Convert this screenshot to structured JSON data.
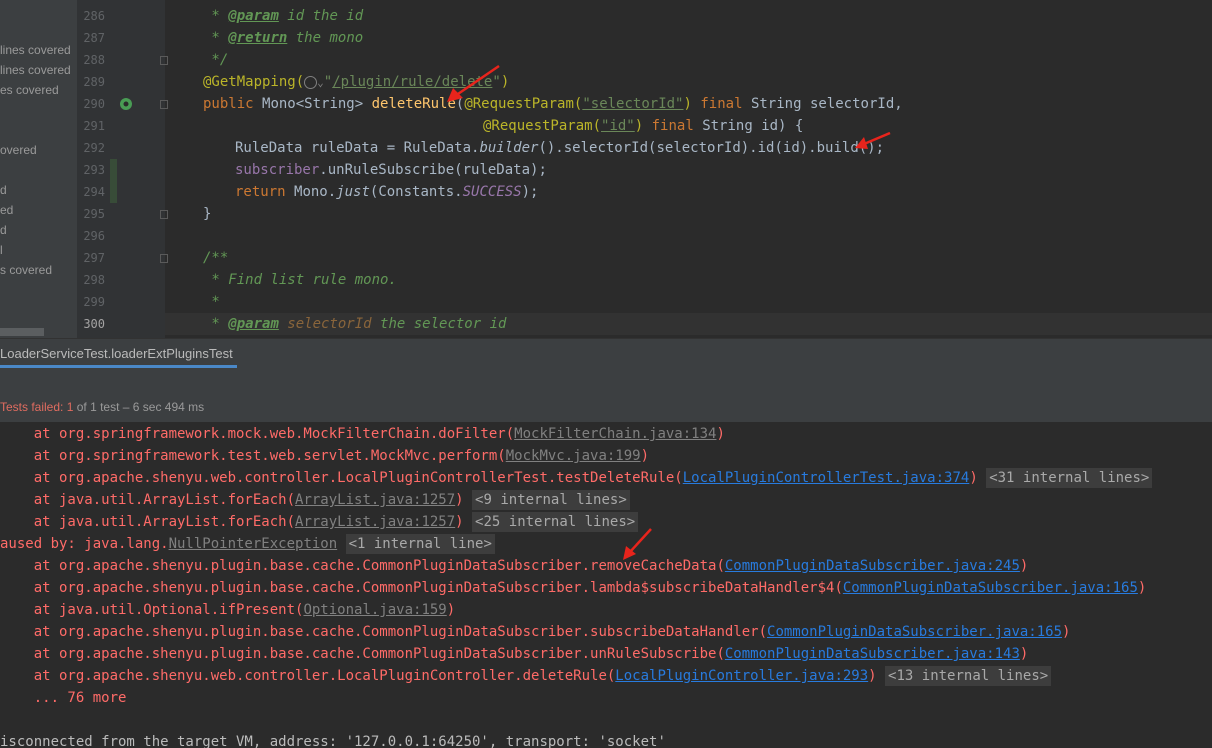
{
  "coverage": {
    "items": [
      {
        "text": "lines covered"
      },
      {
        "text": " lines covered"
      },
      {
        "text": "es covered"
      },
      {
        "text": "overed"
      },
      {
        "text": "d"
      },
      {
        "text": "ed"
      },
      {
        "text": "d"
      },
      {
        "text": "l"
      },
      {
        "text": "s covered"
      }
    ]
  },
  "editor": {
    "line_numbers": [
      "286",
      "287",
      "288",
      "289",
      "290",
      "291",
      "292",
      "293",
      "294",
      "295",
      "296",
      "297",
      "298",
      "299",
      "300"
    ],
    "code": {
      "l286": {
        "star": " * ",
        "tag": "@param",
        "rest": " id the id"
      },
      "l287": {
        "star": " * ",
        "tag": "@return",
        "rest": " the mono"
      },
      "l288": {
        "text": " */"
      },
      "l289": {
        "ann": "@GetMapping(",
        "globe": "globe-icon",
        "chev": "⌄",
        "str_open": "\"",
        "path": "/plugin/rule/delete",
        "str_close": "\"",
        "close": ")"
      },
      "l290": {
        "public": "public ",
        "type": "Mono<String> ",
        "method": "deleteRule",
        "paren": "(",
        "ann": "@RequestParam(",
        "str": "\"selectorId\"",
        "ann_close": ")",
        "final": " final ",
        "rest": "String selectorId,"
      },
      "l291": {
        "ann": "@RequestParam(",
        "str": "\"id\"",
        "ann_close": ")",
        "final": " final ",
        "rest": "String id) {"
      },
      "l292": {
        "a": "RuleData ruleData = RuleData.",
        "builder": "builder",
        "b": "().selectorId(selectorId).id(id).build();"
      },
      "l293": {
        "field": "subscriber",
        "rest": ".unRuleSubscribe(ruleData);"
      },
      "l294": {
        "return": "return ",
        "a": "Mono.",
        "just": "just",
        "b": "(Constants.",
        "success": "SUCCESS",
        "c": ");"
      },
      "l295": {
        "text": "}"
      },
      "l297": {
        "text": "/**"
      },
      "l298": {
        "text": " * Find list rule mono."
      },
      "l299": {
        "text": " *"
      },
      "l300": {
        "star": " * ",
        "tag": "@param",
        "val": " selectorId",
        "rest": " the selector id"
      }
    }
  },
  "run": {
    "tab_label": "LoaderServiceTest.loaderExtPluginsTest",
    "status_failed": "Tests failed: ",
    "status_failed_count": "1",
    "status_rest": " of 1 test – 6 sec 494 ms"
  },
  "console": {
    "lines": [
      {
        "prefix": "    at org.springframework.mock.web.MockFilterChain.doFilter(",
        "link": "MockFilterChain.java:134",
        "link_style": "grey",
        "suffix": ")",
        "internal": ""
      },
      {
        "prefix": "    at org.springframework.test.web.servlet.MockMvc.perform(",
        "link": "MockMvc.java:199",
        "link_style": "grey",
        "suffix": ")",
        "internal": ""
      },
      {
        "prefix": "    at org.apache.shenyu.web.controller.LocalPluginControllerTest.testDeleteRule(",
        "link": "LocalPluginControllerTest.java:374",
        "link_style": "blue",
        "suffix": ")",
        "internal": "<31 internal lines>"
      },
      {
        "prefix": "    at java.util.ArrayList.forEach(",
        "link": "ArrayList.java:1257",
        "link_style": "grey",
        "suffix": ")",
        "internal": "<9 internal lines>"
      },
      {
        "prefix": "    at java.util.ArrayList.forEach(",
        "link": "ArrayList.java:1257",
        "link_style": "grey",
        "suffix": ")",
        "internal": "<25 internal lines>"
      },
      {
        "prefix": "aused by: java.lang.",
        "link": "NullPointerException",
        "link_style": "grey",
        "suffix": "",
        "internal": "<1 internal line>"
      },
      {
        "prefix": "    at org.apache.shenyu.plugin.base.cache.CommonPluginDataSubscriber.removeCacheData(",
        "link": "CommonPluginDataSubscriber.java:245",
        "link_style": "blue",
        "suffix": ")",
        "internal": ""
      },
      {
        "prefix": "    at org.apache.shenyu.plugin.base.cache.CommonPluginDataSubscriber.lambda$subscribeDataHandler$4(",
        "link": "CommonPluginDataSubscriber.java:165",
        "link_style": "blue",
        "suffix": ")",
        "internal": ""
      },
      {
        "prefix": "    at java.util.Optional.ifPresent(",
        "link": "Optional.java:159",
        "link_style": "grey",
        "suffix": ")",
        "internal": ""
      },
      {
        "prefix": "    at org.apache.shenyu.plugin.base.cache.CommonPluginDataSubscriber.subscribeDataHandler(",
        "link": "CommonPluginDataSubscriber.java:165",
        "link_style": "blue",
        "suffix": ")",
        "internal": ""
      },
      {
        "prefix": "    at org.apache.shenyu.plugin.base.cache.CommonPluginDataSubscriber.unRuleSubscribe(",
        "link": "CommonPluginDataSubscriber.java:143",
        "link_style": "blue",
        "suffix": ")",
        "internal": ""
      },
      {
        "prefix": "    at org.apache.shenyu.web.controller.LocalPluginController.deleteRule(",
        "link": "LocalPluginController.java:293",
        "link_style": "blue",
        "suffix": ")",
        "internal": "<13 internal lines>"
      },
      {
        "prefix": "    ... 76 more",
        "link": "",
        "link_style": "",
        "suffix": "",
        "internal": ""
      }
    ],
    "disconnect": "isconnected from the target VM, address: '127.0.0.1:64250', transport: 'socket'"
  },
  "colors": {
    "arrow": "#e8241c",
    "error_text": "#ff6b68",
    "link_blue": "#287bde"
  }
}
